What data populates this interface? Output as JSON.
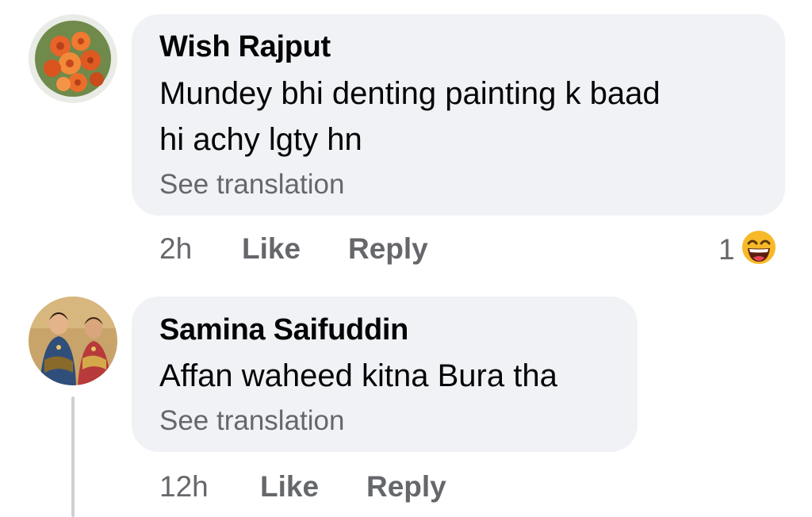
{
  "comments": [
    {
      "author": "Wish Rajput",
      "text_line1": "Mundey bhi denting painting k baad",
      "text_line2": "hi achy lgty hn",
      "see_translation": "See translation",
      "time": "2h",
      "like_label": "Like",
      "reply_label": "Reply",
      "reaction_count": "1",
      "reaction_icon": "laughing-emoji-icon",
      "avatar": "orange-roses-avatar"
    },
    {
      "author": "Samina Saifuddin",
      "text_line1": "Affan waheed kitna Bura tha",
      "see_translation": "See translation",
      "time": "12h",
      "like_label": "Like",
      "reply_label": "Reply",
      "avatar": "painted-women-avatar"
    }
  ],
  "colors": {
    "bubble": "#f0f2f5",
    "secondary_text": "#65676b",
    "primary_text": "#050505",
    "thread_line": "#ced0d4",
    "emoji_yellow": "#f7b928"
  }
}
